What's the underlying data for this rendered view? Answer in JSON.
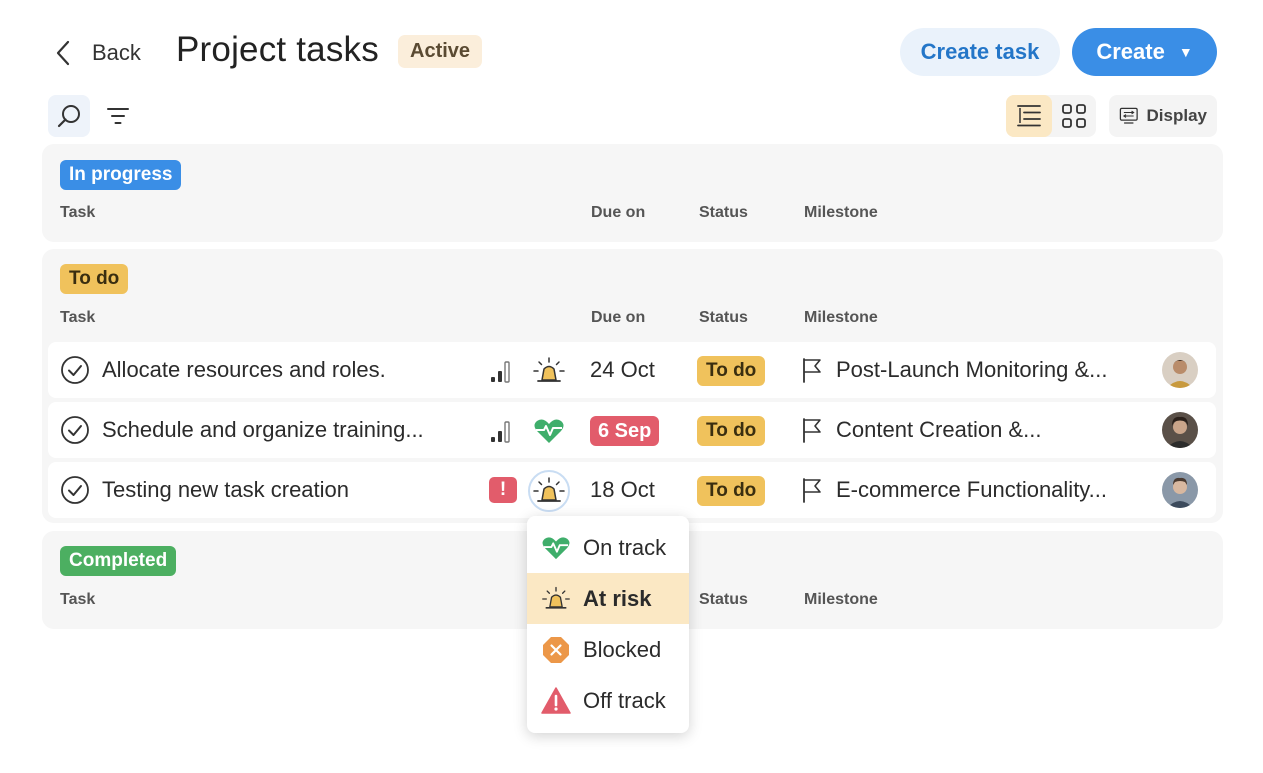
{
  "header": {
    "back_label": "Back",
    "title": "Project tasks",
    "project_status": "Active",
    "create_task_label": "Create task",
    "create_label": "Create"
  },
  "toolbar": {
    "display_label": "Display",
    "active_view": "list"
  },
  "columns": {
    "task": "Task",
    "due_on": "Due on",
    "status": "Status",
    "milestone": "Milestone"
  },
  "sections": [
    {
      "label": "In progress",
      "color": "#3a8ee6",
      "text_color": "#ffffff"
    },
    {
      "label": "To do",
      "color": "#f0c25c",
      "text_color": "#3a2e10"
    },
    {
      "label": "Completed",
      "color": "#4caf61",
      "text_color": "#ffffff"
    }
  ],
  "tasks": [
    {
      "title": "Allocate resources and roles.",
      "priority_icon": "signal-bars-icon",
      "health_icon": "siren-icon",
      "due": "24 Oct",
      "due_overdue": false,
      "status": "To do",
      "milestone": "Post-Launch Monitoring &..."
    },
    {
      "title": "Schedule and organize training...",
      "priority_icon": "signal-bars-icon",
      "health_icon": "heartbeat-icon",
      "due": "6 Sep",
      "due_overdue": true,
      "status": "To do",
      "milestone": "Content Creation &..."
    },
    {
      "title": "Testing new task creation",
      "priority_icon": "urgent-alert-icon",
      "priority_text": "!",
      "health_icon": "siren-icon",
      "due": "18 Oct",
      "due_overdue": false,
      "status": "To do",
      "milestone": "E-commerce Functionality..."
    }
  ],
  "health_menu": {
    "items": [
      {
        "label": "On track",
        "icon": "heartbeat-icon",
        "color": "#3fae6b",
        "selected": false
      },
      {
        "label": "At risk",
        "icon": "siren-icon",
        "color": "#e3a93b",
        "selected": true
      },
      {
        "label": "Blocked",
        "icon": "blocked-icon",
        "color": "#ec9748",
        "selected": false
      },
      {
        "label": "Off track",
        "icon": "warning-icon",
        "color": "#e25c6b",
        "selected": false
      }
    ]
  },
  "colors": {
    "accent_blue": "#3a8ee6",
    "status_todo": "#f0c25c",
    "overdue_red": "#e25c6b",
    "selected_row": "#fbe8c4"
  }
}
